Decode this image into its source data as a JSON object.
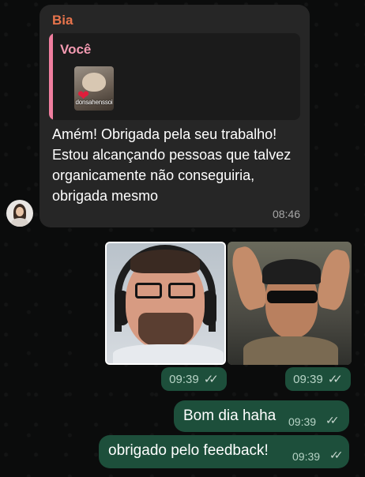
{
  "incoming": {
    "sender": "Bia",
    "reply": {
      "author": "Você",
      "sticker_caption": "donsahenssoi"
    },
    "text": "Amém! Obrigada pela seu trabalho! Estou alcançando pessoas que talvez organicamente não conseguiria, obrigada mesmo",
    "time": "08:46"
  },
  "media": [
    {
      "time": "09:39",
      "status_icon": "double-check-icon"
    },
    {
      "time": "09:39",
      "status_icon": "double-check-icon"
    }
  ],
  "outgoing": [
    {
      "text": "Bom dia haha",
      "time": "09:39",
      "status_icon": "double-check-icon"
    },
    {
      "text": "obrigado pelo feedback!",
      "time": "09:39",
      "status_icon": "double-check-icon"
    }
  ],
  "colors": {
    "background": "#0b0c0c",
    "incoming_bubble": "#262626",
    "outgoing_bubble": "#1d4f3b",
    "sender_name": "#e8744c",
    "reply_accent": "#f07e9f"
  }
}
